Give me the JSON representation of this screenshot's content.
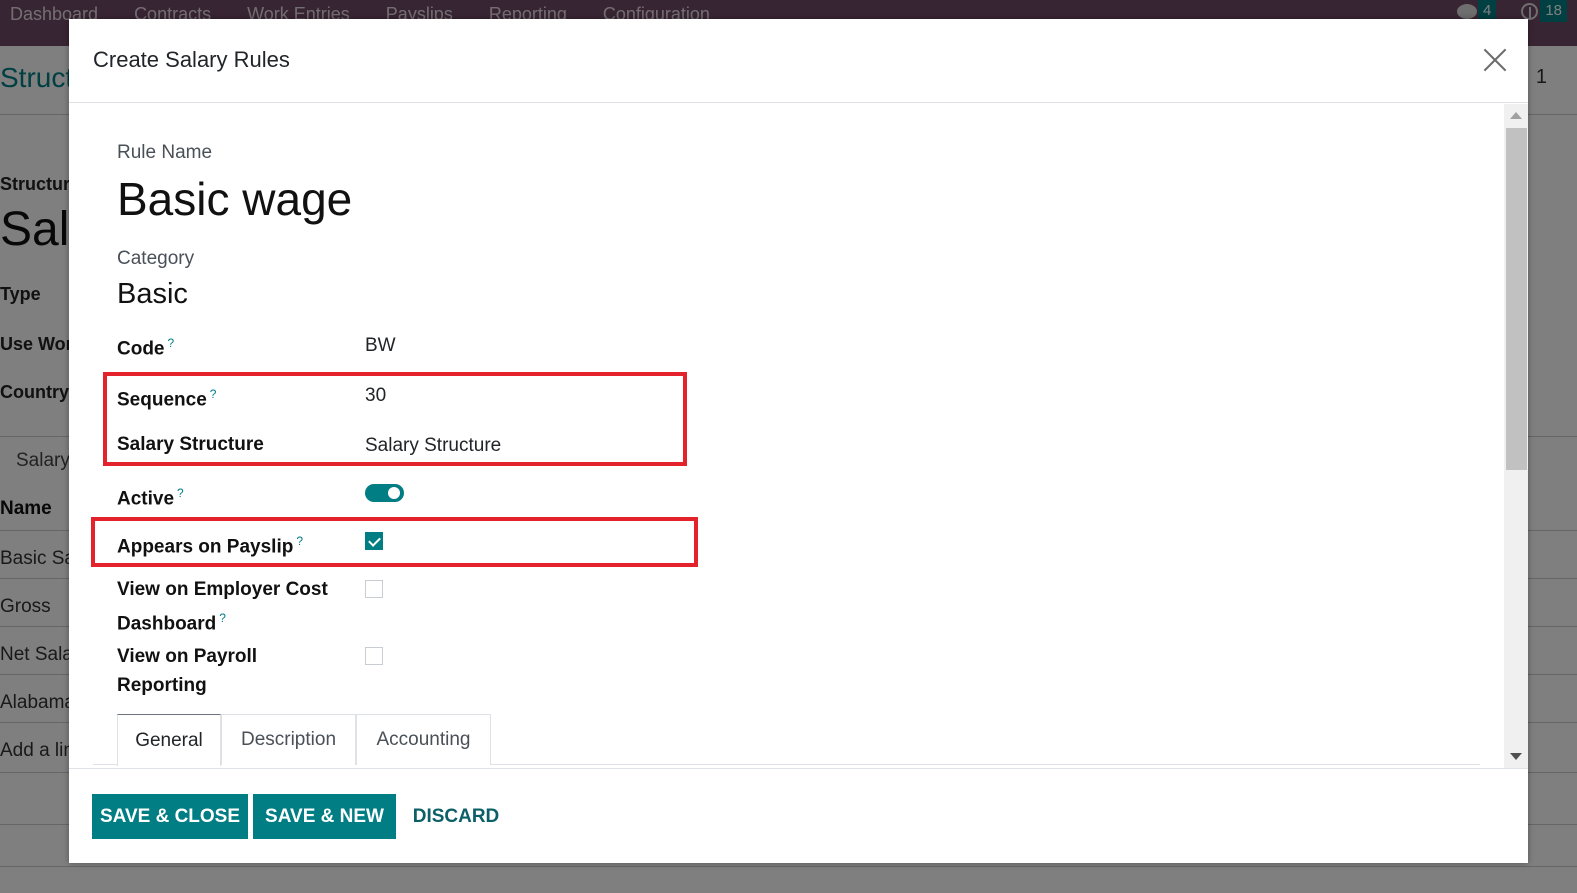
{
  "navbar": {
    "items": [
      "Dashboard",
      "Contracts",
      "Work Entries",
      "Payslips",
      "Reporting",
      "Configuration"
    ],
    "messages_icon": "chat-bubble-icon",
    "messages_count": "4",
    "activities_icon": "clock-icon",
    "activities_count": "18",
    "badge_color": "#017e84",
    "bar_color": "#714b67"
  },
  "background": {
    "breadcrumb": "Structures",
    "pager": "1",
    "structure_label": "Structure",
    "structure_title": "Salary Structure",
    "fields": [
      "Type",
      "Use Worked Day Lines",
      "Country"
    ],
    "tab": "Salary Rules",
    "list_header": "Name",
    "list_rows": [
      "Basic Salary",
      "Gross",
      "Net Salary",
      "Alabama"
    ],
    "add_line": "Add a line"
  },
  "modal": {
    "title": "Create Salary Rules",
    "close_icon": "close-icon",
    "rule_name_label": "Rule Name",
    "rule_name": "Basic wage",
    "category_label": "Category",
    "category": "Basic",
    "help_marker": "?",
    "fields": {
      "code": {
        "label": "Code",
        "value": "BW"
      },
      "sequence": {
        "label": "Sequence",
        "value": "30"
      },
      "salary_structure": {
        "label": "Salary Structure",
        "value": "Salary Structure"
      },
      "active": {
        "label": "Active",
        "value": true
      },
      "appears_on_payslip": {
        "label": "Appears on Payslip",
        "value": true
      },
      "employer_cost": {
        "label_line1": "View on Employer Cost",
        "label_line2": "Dashboard",
        "value": false
      },
      "payroll_reporting": {
        "label_line1": "View on Payroll",
        "label_line2": "Reporting",
        "value": false
      }
    },
    "tabs": [
      {
        "label": "General",
        "active": true
      },
      {
        "label": "Description",
        "active": false
      },
      {
        "label": "Accounting",
        "active": false
      }
    ],
    "buttons": {
      "save_close": "SAVE & CLOSE",
      "save_new": "SAVE & NEW",
      "discard": "DISCARD"
    },
    "accent_color": "#017e84",
    "highlight_color": "#e3222b"
  }
}
